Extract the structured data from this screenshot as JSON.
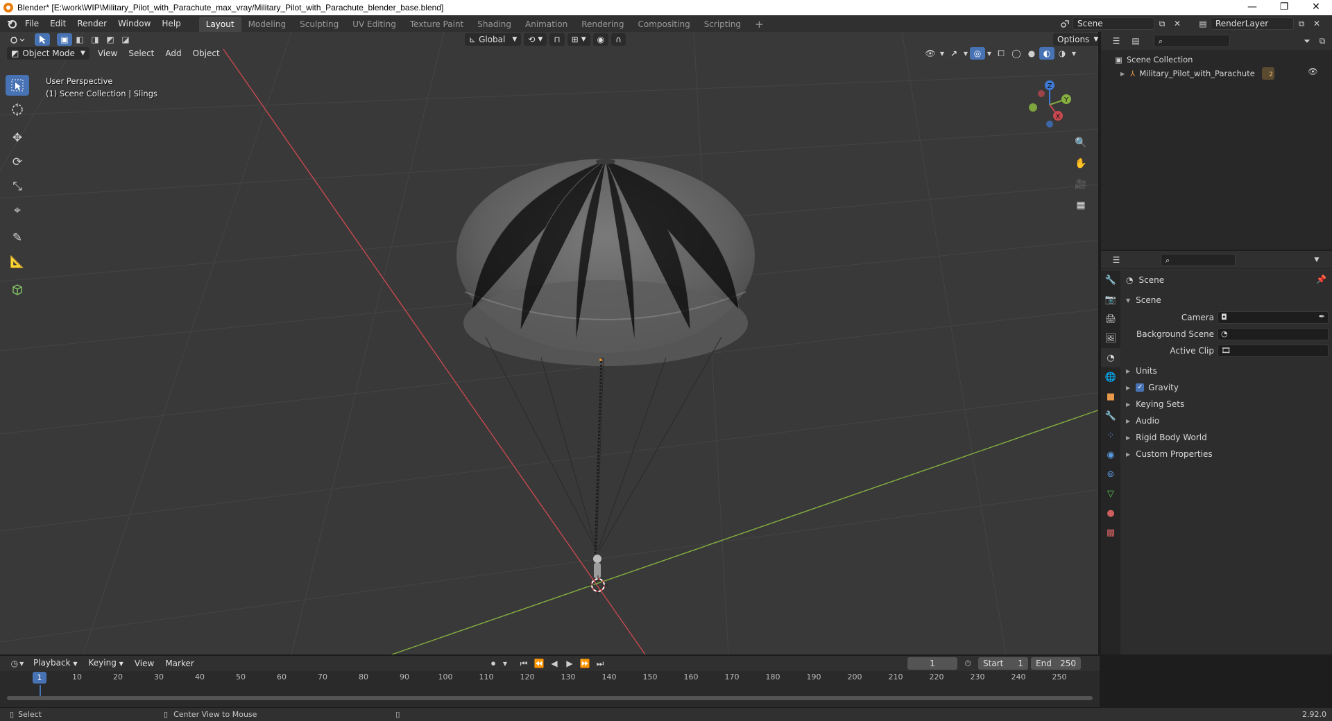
{
  "window": {
    "title": "Blender* [E:\\work\\WIP\\Military_Pilot_with_Parachute_max_vray/Military_Pilot_with_Parachute_blender_base.blend]",
    "minimize": "—",
    "maximize": "❐",
    "close": "✕"
  },
  "menu": {
    "items": [
      "File",
      "Edit",
      "Render",
      "Window",
      "Help"
    ]
  },
  "workspaces": [
    "Layout",
    "Modeling",
    "Sculpting",
    "UV Editing",
    "Texture Paint",
    "Shading",
    "Animation",
    "Rendering",
    "Compositing",
    "Scripting"
  ],
  "workspace_add": "+",
  "scene_selector": {
    "value": "Scene"
  },
  "viewlayer_selector": {
    "value": "RenderLayer"
  },
  "viewport": {
    "mode": "Object Mode",
    "menus": [
      "View",
      "Select",
      "Add",
      "Object"
    ],
    "transform_orientation": "Global",
    "options_label": "Options",
    "overlay_line1": "User Perspective",
    "overlay_line2": "(1) Scene Collection | Slings",
    "gizmo": {
      "x": "X",
      "y": "Y",
      "z": "Z"
    },
    "colors": {
      "x_axis": "#c8484f",
      "y_axis": "#86b03f",
      "z_axis": "#3e7ad6",
      "select_accent": "#4772b3"
    }
  },
  "toolbar": {
    "tools": [
      "select-box-icon",
      "cursor-icon",
      "move-icon",
      "rotate-icon",
      "scale-icon",
      "transform-icon",
      "annotate-icon",
      "measure-icon",
      "add-cube-icon"
    ]
  },
  "outliner": {
    "root": "Scene Collection",
    "items": [
      {
        "label": "Military_Pilot_with_Parachute",
        "badge": "2"
      }
    ]
  },
  "properties": {
    "context_title": "Scene",
    "panel_title": "Scene",
    "fields": [
      {
        "label": "Camera",
        "value": ""
      },
      {
        "label": "Background Scene",
        "value": ""
      },
      {
        "label": "Active Clip",
        "value": ""
      }
    ],
    "sections": [
      {
        "label": "Units",
        "checkbox": false
      },
      {
        "label": "Gravity",
        "checkbox": true
      },
      {
        "label": "Keying Sets",
        "checkbox": false
      },
      {
        "label": "Audio",
        "checkbox": false
      },
      {
        "label": "Rigid Body World",
        "checkbox": false
      },
      {
        "label": "Custom Properties",
        "checkbox": false
      }
    ]
  },
  "timeline": {
    "menus": [
      "Playback",
      "Keying",
      "View",
      "Marker"
    ],
    "current_frame": "1",
    "start_label": "Start",
    "start": "1",
    "end_label": "End",
    "end": "250",
    "playhead": "1",
    "ticks": [
      "10",
      "20",
      "30",
      "40",
      "50",
      "60",
      "70",
      "80",
      "90",
      "100",
      "110",
      "120",
      "130",
      "140",
      "150",
      "160",
      "170",
      "180",
      "190",
      "200",
      "210",
      "220",
      "230",
      "240",
      "250"
    ]
  },
  "statusbar": {
    "left_action": "Select",
    "middle_action": "Center View to Mouse",
    "version": "2.92.0"
  }
}
